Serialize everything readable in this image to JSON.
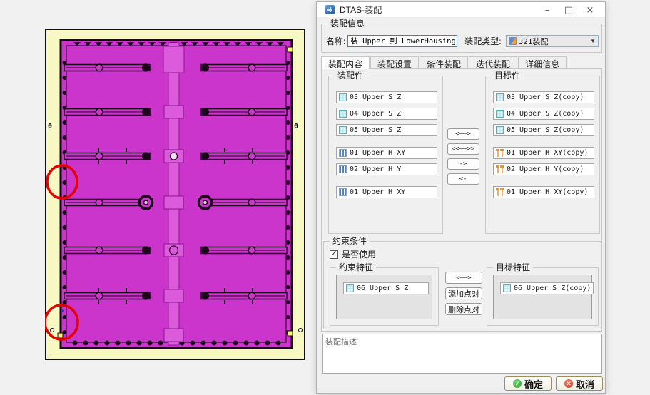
{
  "window": {
    "title": "DTAS-装配",
    "controls": {
      "minimize": "–",
      "maximize": "□",
      "close": "×"
    }
  },
  "assembly_info": {
    "group_label": "装配信息",
    "name_label": "名称:",
    "name_value": "装 Upper 到 LowerHousing",
    "type_label": "装配类型:",
    "type_value": "321装配"
  },
  "tabs": [
    {
      "label": "装配内容",
      "active": true
    },
    {
      "label": "装配设置",
      "active": false
    },
    {
      "label": "条件装配",
      "active": false
    },
    {
      "label": "迭代装配",
      "active": false
    },
    {
      "label": "详细信息",
      "active": false
    }
  ],
  "assembly_parts": {
    "group_label": "装配件",
    "items": [
      {
        "label": "03 Upper S Z",
        "icon": "sz-feature-icon"
      },
      {
        "label": "04 Upper S Z",
        "icon": "sz-feature-icon"
      },
      {
        "label": "05 Upper S Z",
        "icon": "sz-feature-icon"
      },
      {
        "label": "01 Upper H XY",
        "icon": "hole-feature-icon"
      },
      {
        "label": "02 Upper H Y",
        "icon": "hole-feature-icon"
      },
      {
        "label": "01 Upper H XY",
        "icon": "hole-feature-icon"
      }
    ]
  },
  "target_parts": {
    "group_label": "目标件",
    "items": [
      {
        "label": "03 Upper S Z(copy)",
        "icon": "sz-feature-icon"
      },
      {
        "label": "04 Upper S Z(copy)",
        "icon": "sz-feature-icon"
      },
      {
        "label": "05 Upper S Z(copy)",
        "icon": "sz-feature-icon"
      },
      {
        "label": "01 Upper H XY(copy)",
        "icon": "pin-feature-icon"
      },
      {
        "label": "02 Upper H Y(copy)",
        "icon": "pin-feature-icon"
      },
      {
        "label": "01 Upper H XY(copy)",
        "icon": "pin-feature-icon"
      }
    ]
  },
  "transfer_buttons": {
    "map_pair": "<——>",
    "map_all": "<<——>>",
    "to_right": "->",
    "to_left": "<-"
  },
  "constraints": {
    "group_label": "约束条件",
    "use_label": "是否使用",
    "use_checked": true,
    "check_glyph": "✓",
    "constraint_features": {
      "group_label": "约束特征",
      "item": {
        "label": "06 Upper S Z",
        "icon": "sz-feature-icon"
      }
    },
    "target_features": {
      "group_label": "目标特征",
      "item": {
        "label": "06 Upper S Z(copy)",
        "icon": "sz-feature-icon"
      }
    },
    "buttons": {
      "map_pair": "<——>",
      "add_pair": "添加点对",
      "remove_pair": "删除点对"
    }
  },
  "description": {
    "placeholder": "装配描述",
    "value": ""
  },
  "footer": {
    "ok": "确定",
    "cancel": "取消",
    "ok_glyph": "✓",
    "cancel_glyph": "✕"
  },
  "viewport": {
    "zero_label_left": "0",
    "zero_label_right": "0",
    "colors": {
      "board_yellow": "#f8f8c2",
      "plate_magenta": "#cb35cb",
      "strip_pink": "#dc5adc",
      "outline_dark": "#1c051c",
      "annotation_red": "#e60000"
    }
  }
}
